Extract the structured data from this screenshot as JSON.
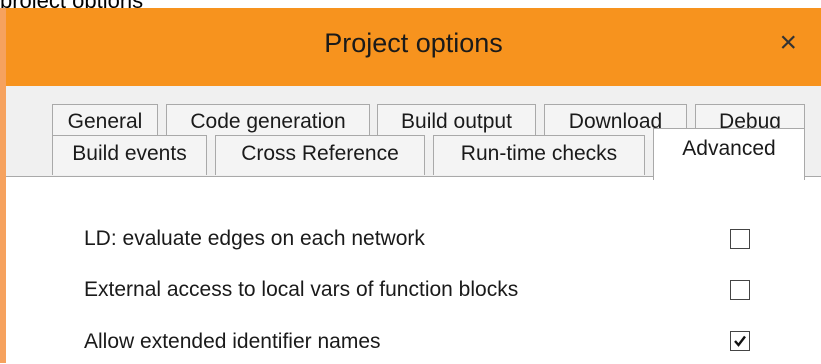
{
  "caption": "project options",
  "window": {
    "title": "Project options",
    "close_glyph": "×",
    "accent_color": "#f7931e"
  },
  "tabs": {
    "row1": [
      "General",
      "Code generation",
      "Build output",
      "Download",
      "Debug"
    ],
    "row2": [
      "Build events",
      "Cross Reference",
      "Run-time checks",
      "Advanced"
    ],
    "active": "Advanced"
  },
  "options": [
    {
      "label": "LD: evaluate edges on each network",
      "checked": false
    },
    {
      "label": "External access to local vars of function blocks",
      "checked": false
    },
    {
      "label": "Allow extended identifier names",
      "checked": true
    }
  ]
}
